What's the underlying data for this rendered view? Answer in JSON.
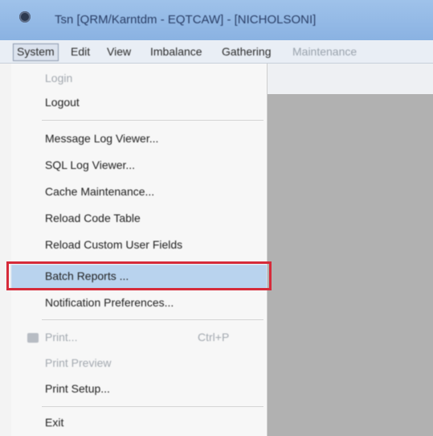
{
  "window": {
    "title": "Tsn [QRM/Karntdm - EQTCAW] - [NICHOLSONI]"
  },
  "menubar": {
    "items": [
      {
        "label": "System"
      },
      {
        "label": "Edit"
      },
      {
        "label": "View"
      },
      {
        "label": "Imbalance"
      },
      {
        "label": "Gathering"
      },
      {
        "label": "Maintenance"
      }
    ]
  },
  "system_menu": {
    "items": [
      {
        "label": "Login",
        "enabled": false
      },
      {
        "label": "Logout",
        "enabled": true
      },
      {
        "label": "Message Log Viewer...",
        "enabled": true
      },
      {
        "label": "SQL Log Viewer...",
        "enabled": true
      },
      {
        "label": "Cache Maintenance...",
        "enabled": true
      },
      {
        "label": "Reload Code Table",
        "enabled": true
      },
      {
        "label": "Reload Custom User Fields",
        "enabled": true
      },
      {
        "label": "Batch Reports ...",
        "enabled": true,
        "highlighted": true
      },
      {
        "label": "Notification Preferences...",
        "enabled": true
      },
      {
        "label": "Print...",
        "shortcut": "Ctrl+P",
        "enabled": false,
        "icon": "printer-icon"
      },
      {
        "label": "Print Preview",
        "enabled": false
      },
      {
        "label": "Print Setup...",
        "enabled": true
      },
      {
        "label": "Exit",
        "enabled": true
      }
    ]
  },
  "colors": {
    "titlebar": "#8ab2e2",
    "highlight_fill": "#b9d3ee",
    "annotation_border": "#d62b3a",
    "workspace": "#b1b1b1"
  }
}
